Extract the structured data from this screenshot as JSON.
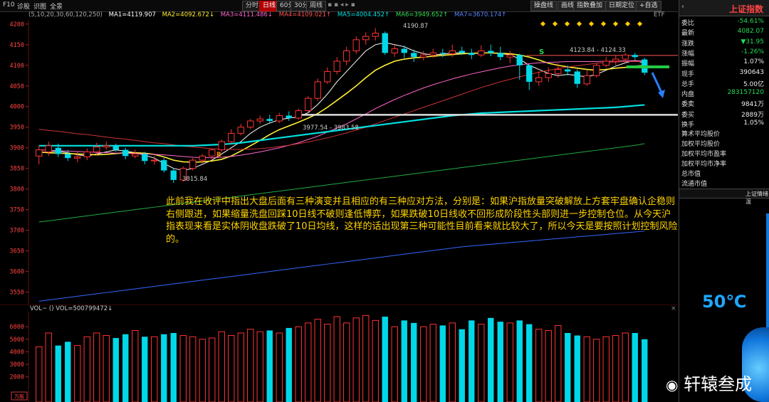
{
  "toolbar": {
    "left_items": [
      "F10",
      "诊股",
      "识图",
      "全景"
    ],
    "periods": [
      "分时",
      "日线",
      "60分",
      "30分",
      "周线"
    ],
    "active_period": "日线",
    "right_buttons": [
      "操盘线",
      "画线",
      "指数叠加",
      "日期定位",
      "+自选"
    ],
    "etf_label": "ETF"
  },
  "ma": {
    "params": "(5,10,20,30,60,120,250)",
    "ma1": "MA1=4119.907",
    "ma2": "MA2=4092.672↓",
    "ma3": "MA3=4111.486↓",
    "ma4": "MA4=4109.021↑",
    "ma5": "MA5=4004.452↑",
    "ma6": "MA6=3949.652↑",
    "ma7": "MA7=3670.174↑"
  },
  "chart_annotations": {
    "high": "4190.87",
    "low": "3815.84",
    "range1": "3977.54 - 3983.58",
    "range2": "4123.84 - 4124.33",
    "b_label": "B",
    "s_label": "S"
  },
  "vol_header": "VOL~  () VOL=500799472↓",
  "vol_unit": "万股",
  "annotation_text": "此前我在收评中指出大盘后面有三种演变并且相应的有三种应对方法，分别是：如果沪指放量突破解放上方套牢盘确认企稳则右侧跟进，如果缩量洗盘回踩10日线不破则逢低博弈，如果跌破10日线收不回形成阶段性头部则进一步控制仓位。从今天沪指表现来看是实体阴收盘跌破了10日均线，这样的话出现第三种可能性目前看来就比较大了，所以今天是要按照计划控制风险的。",
  "side": {
    "title": "上证指数",
    "rows": [
      {
        "k": "委比",
        "v": "-54.61%",
        "c": "green"
      },
      {
        "k": "最新",
        "v": "4082.07",
        "c": "green"
      },
      {
        "k": "涨跌",
        "v": "▼31.95",
        "c": "green"
      },
      {
        "k": "涨幅",
        "v": "-1.26%",
        "c": "green"
      },
      {
        "k": "振幅",
        "v": "1.07%",
        "c": "white"
      },
      {
        "k": "现手",
        "v": "390643",
        "c": "white"
      },
      {
        "k": "总手",
        "v": "5.00亿",
        "c": "white"
      },
      {
        "k": "内盘",
        "v": "283157120",
        "c": "green"
      },
      {
        "k": "委卖",
        "v": "9841万",
        "c": "white"
      },
      {
        "k": "委买",
        "v": "2889万",
        "c": "white"
      },
      {
        "k": "换手",
        "v": "1.05%",
        "c": "white"
      }
    ],
    "links": [
      "算术平均股价",
      "加权平均股价",
      "加权平均市盈率",
      "加权平均市净率",
      "总市值",
      "流通市值"
    ],
    "panel_title": "上证情绪温",
    "temperature": "50℃"
  },
  "watermark": "轩辕叁成",
  "chart_data": {
    "type": "candlestick",
    "y_ticks": [
      4200,
      4150,
      4100,
      4050,
      4000,
      3950,
      3900,
      3850,
      3800,
      3750,
      3700,
      3650,
      3600,
      3550
    ],
    "ylim": [
      3520,
      4210
    ],
    "vol_ticks": [
      6000,
      5000,
      4000,
      3000,
      2000
    ],
    "vol_ylim": [
      0,
      7200
    ],
    "candles": [
      {
        "o": 3880,
        "c": 3895,
        "h": 3905,
        "l": 3860,
        "v": 4400
      },
      {
        "o": 3890,
        "c": 3905,
        "h": 3915,
        "l": 3880,
        "v": 5500
      },
      {
        "o": 3900,
        "c": 3885,
        "h": 3910,
        "l": 3878,
        "v": 4500
      },
      {
        "o": 3885,
        "c": 3875,
        "h": 3895,
        "l": 3868,
        "v": 4800
      },
      {
        "o": 3875,
        "c": 3878,
        "h": 3890,
        "l": 3865,
        "v": 4500
      },
      {
        "o": 3878,
        "c": 3890,
        "h": 3898,
        "l": 3870,
        "v": 5200
      },
      {
        "o": 3890,
        "c": 3902,
        "h": 3912,
        "l": 3882,
        "v": 5500
      },
      {
        "o": 3902,
        "c": 3905,
        "h": 3915,
        "l": 3895,
        "v": 5300
      },
      {
        "o": 3905,
        "c": 3895,
        "h": 3910,
        "l": 3890,
        "v": 5100
      },
      {
        "o": 3895,
        "c": 3880,
        "h": 3900,
        "l": 3872,
        "v": 5400
      },
      {
        "o": 3880,
        "c": 3885,
        "h": 3895,
        "l": 3875,
        "v": 5700
      },
      {
        "o": 3885,
        "c": 3868,
        "h": 3890,
        "l": 3860,
        "v": 5200
      },
      {
        "o": 3868,
        "c": 3870,
        "h": 3880,
        "l": 3860,
        "v": 5200
      },
      {
        "o": 3870,
        "c": 3845,
        "h": 3875,
        "l": 3840,
        "v": 5400
      },
      {
        "o": 3845,
        "c": 3822,
        "h": 3850,
        "l": 3815,
        "v": 5500
      },
      {
        "o": 3822,
        "c": 3850,
        "h": 3855,
        "l": 3818,
        "v": 5300
      },
      {
        "o": 3850,
        "c": 3870,
        "h": 3875,
        "l": 3845,
        "v": 5200
      },
      {
        "o": 3870,
        "c": 3880,
        "h": 3885,
        "l": 3862,
        "v": 5000
      },
      {
        "o": 3880,
        "c": 3895,
        "h": 3898,
        "l": 3872,
        "v": 5100
      },
      {
        "o": 3895,
        "c": 3915,
        "h": 3920,
        "l": 3890,
        "v": 5600
      },
      {
        "o": 3915,
        "c": 3935,
        "h": 3945,
        "l": 3910,
        "v": 5300
      },
      {
        "o": 3935,
        "c": 3950,
        "h": 3958,
        "l": 3930,
        "v": 5500
      },
      {
        "o": 3950,
        "c": 3965,
        "h": 3970,
        "l": 3945,
        "v": 5800
      },
      {
        "o": 3965,
        "c": 3970,
        "h": 3978,
        "l": 3958,
        "v": 5600
      },
      {
        "o": 3970,
        "c": 3965,
        "h": 3980,
        "l": 3960,
        "v": 5700
      },
      {
        "o": 3965,
        "c": 3978,
        "h": 3985,
        "l": 3960,
        "v": 5500
      },
      {
        "o": 3978,
        "c": 3972,
        "h": 3988,
        "l": 3965,
        "v": 5900
      },
      {
        "o": 3972,
        "c": 3990,
        "h": 3995,
        "l": 3968,
        "v": 6000
      },
      {
        "o": 3990,
        "c": 4020,
        "h": 4025,
        "l": 3985,
        "v": 6300
      },
      {
        "o": 4020,
        "c": 4060,
        "h": 4068,
        "l": 4015,
        "v": 6600
      },
      {
        "o": 4060,
        "c": 4085,
        "h": 4095,
        "l": 4055,
        "v": 6200
      },
      {
        "o": 4085,
        "c": 4110,
        "h": 4120,
        "l": 4078,
        "v": 6800
      },
      {
        "o": 4110,
        "c": 4135,
        "h": 4145,
        "l": 4100,
        "v": 6300
      },
      {
        "o": 4135,
        "c": 4162,
        "h": 4170,
        "l": 4128,
        "v": 6700
      },
      {
        "o": 4162,
        "c": 4170,
        "h": 4180,
        "l": 4150,
        "v": 6900
      },
      {
        "o": 4170,
        "c": 4178,
        "h": 4190,
        "l": 4160,
        "v": 6500
      },
      {
        "o": 4178,
        "c": 4130,
        "h": 4182,
        "l": 4125,
        "v": 6800
      },
      {
        "o": 4130,
        "c": 4140,
        "h": 4150,
        "l": 4120,
        "v": 6000
      },
      {
        "o": 4140,
        "c": 4130,
        "h": 4148,
        "l": 4118,
        "v": 6500
      },
      {
        "o": 4130,
        "c": 4120,
        "h": 4138,
        "l": 4108,
        "v": 6300
      },
      {
        "o": 4120,
        "c": 4125,
        "h": 4135,
        "l": 4112,
        "v": 6000
      },
      {
        "o": 4125,
        "c": 4130,
        "h": 4140,
        "l": 4118,
        "v": 6200
      },
      {
        "o": 4130,
        "c": 4128,
        "h": 4140,
        "l": 4120,
        "v": 6100
      },
      {
        "o": 4128,
        "c": 4135,
        "h": 4150,
        "l": 4120,
        "v": 6300
      },
      {
        "o": 4135,
        "c": 4130,
        "h": 4145,
        "l": 4125,
        "v": 5800
      },
      {
        "o": 4130,
        "c": 4125,
        "h": 4140,
        "l": 4115,
        "v": 6500
      },
      {
        "o": 4125,
        "c": 4135,
        "h": 4148,
        "l": 4120,
        "v": 6200
      },
      {
        "o": 4135,
        "c": 4130,
        "h": 4150,
        "l": 4122,
        "v": 6700
      },
      {
        "o": 4130,
        "c": 4120,
        "h": 4145,
        "l": 4112,
        "v": 6400
      },
      {
        "o": 4120,
        "c": 4125,
        "h": 4135,
        "l": 4105,
        "v": 6300
      },
      {
        "o": 4125,
        "c": 4100,
        "h": 4128,
        "l": 4065,
        "v": 6500
      },
      {
        "o": 4100,
        "c": 4060,
        "h": 4102,
        "l": 4040,
        "v": 6200
      },
      {
        "o": 4060,
        "c": 4070,
        "h": 4085,
        "l": 4050,
        "v": 5800
      },
      {
        "o": 4070,
        "c": 4080,
        "h": 4095,
        "l": 4060,
        "v": 5700
      },
      {
        "o": 4080,
        "c": 4090,
        "h": 4105,
        "l": 4070,
        "v": 6100
      },
      {
        "o": 4090,
        "c": 4085,
        "h": 4100,
        "l": 4075,
        "v": 5500
      },
      {
        "o": 4085,
        "c": 4055,
        "h": 4090,
        "l": 4045,
        "v": 5300
      },
      {
        "o": 4055,
        "c": 4075,
        "h": 4088,
        "l": 4050,
        "v": 5200
      },
      {
        "o": 4075,
        "c": 4100,
        "h": 4105,
        "l": 4070,
        "v": 5000
      },
      {
        "o": 4100,
        "c": 4110,
        "h": 4120,
        "l": 4095,
        "v": 5200
      },
      {
        "o": 4110,
        "c": 4115,
        "h": 4125,
        "l": 4100,
        "v": 5300
      },
      {
        "o": 4115,
        "c": 4125,
        "h": 4130,
        "l": 4110,
        "v": 5500
      },
      {
        "o": 4125,
        "c": 4120,
        "h": 4130,
        "l": 4115,
        "v": 5500
      },
      {
        "o": 4114,
        "c": 4082,
        "h": 4118,
        "l": 4076,
        "v": 5000
      }
    ],
    "ma_lines": [
      {
        "name": "MA5",
        "color": "#ffffff",
        "values": [
          3888,
          3890,
          3892,
          3888,
          3883,
          3880,
          3885,
          3890,
          3895,
          3892,
          3888,
          3882,
          3875,
          3862,
          3850,
          3845,
          3850,
          3860,
          3870,
          3885,
          3900,
          3915,
          3935,
          3950,
          3960,
          3968,
          3972,
          3975,
          3985,
          4005,
          4030,
          4060,
          4085,
          4110,
          4135,
          4150,
          4155,
          4150,
          4145,
          4135,
          4128,
          4125,
          4127,
          4130,
          4130,
          4128,
          4130,
          4130,
          4128,
          4126,
          4115,
          4100,
          4090,
          4080,
          4075,
          4078,
          4075,
          4072,
          4078,
          4088,
          4098,
          4106,
          4112,
          4105
        ]
      },
      {
        "name": "MA10",
        "color": "#ffee33",
        "values": [
          3890,
          3888,
          3887,
          3886,
          3885,
          3884,
          3883,
          3884,
          3886,
          3888,
          3888,
          3887,
          3884,
          3878,
          3870,
          3866,
          3865,
          3866,
          3868,
          3872,
          3880,
          3892,
          3905,
          3918,
          3932,
          3944,
          3953,
          3962,
          3972,
          3983,
          3998,
          4015,
          4032,
          4050,
          4070,
          4088,
          4100,
          4110,
          4115,
          4118,
          4120,
          4122,
          4124,
          4126,
          4128,
          4129,
          4130,
          4130,
          4129,
          4128,
          4125,
          4120,
          4113,
          4105,
          4100,
          4096,
          4093,
          4090,
          4088,
          4090,
          4093,
          4095,
          4098,
          4100
        ]
      },
      {
        "name": "MA20",
        "color": "#ff66cc",
        "values": [
          3895,
          3894,
          3893,
          3892,
          3891,
          3890,
          3889,
          3888,
          3887,
          3887,
          3886,
          3885,
          3884,
          3883,
          3881,
          3879,
          3877,
          3876,
          3876,
          3877,
          3879,
          3882,
          3886,
          3890,
          3895,
          3900,
          3906,
          3912,
          3920,
          3928,
          3938,
          3948,
          3958,
          3970,
          3982,
          3995,
          4006,
          4017,
          4027,
          4036,
          4045,
          4053,
          4060,
          4067,
          4073,
          4079,
          4084,
          4089,
          4094,
          4098,
          4101,
          4104,
          4106,
          4107,
          4108,
          4109,
          4109,
          4109,
          4109,
          4110,
          4110,
          4111,
          4111,
          4111
        ]
      },
      {
        "name": "MA30",
        "color": "#cc3333",
        "values": [
          3945,
          3942,
          3940,
          3937,
          3934,
          3932,
          3929,
          3926,
          3923,
          3921,
          3918,
          3915,
          3912,
          3910,
          3907,
          3904,
          3902,
          3900,
          3898,
          3897,
          3896,
          3896,
          3897,
          3898,
          3900,
          3903,
          3906,
          3910,
          3914,
          3919,
          3924,
          3930,
          3936,
          3943,
          3950,
          3958,
          3966,
          3974,
          3982,
          3990,
          3998,
          4006,
          4014,
          4022,
          4030,
          4038,
          4046,
          4053,
          4060,
          4066,
          4072,
          4078,
          4083,
          4088,
          4092,
          4096,
          4099,
          4102,
          4105,
          4107,
          4108,
          4109,
          4109,
          4109
        ]
      },
      {
        "name": "MA60",
        "color": "#00e0e0",
        "values": [
          3905,
          3905,
          3905,
          3905,
          3905,
          3905,
          3905,
          3905,
          3905,
          3905,
          3905,
          3905,
          3905,
          3905,
          3905,
          3905,
          3905,
          3906,
          3907,
          3908,
          3910,
          3912,
          3915,
          3918,
          3921,
          3924,
          3927,
          3930,
          3933,
          3936,
          3939,
          3942,
          3945,
          3948,
          3951,
          3954,
          3957,
          3960,
          3963,
          3966,
          3969,
          3972,
          3975,
          3978,
          3980,
          3982,
          3984,
          3985,
          3986,
          3987,
          3988,
          3989,
          3990,
          3991,
          3992,
          3993,
          3994,
          3995,
          3996,
          3997,
          3998,
          4000,
          4002,
          4004
        ]
      },
      {
        "name": "MA120",
        "color": "#22aa44",
        "values": [
          3720,
          3723,
          3726,
          3729,
          3732,
          3735,
          3738,
          3741,
          3744,
          3747,
          3750,
          3753,
          3756,
          3759,
          3762,
          3765,
          3768,
          3771,
          3774,
          3777,
          3780,
          3783,
          3786,
          3789,
          3792,
          3795,
          3798,
          3801,
          3804,
          3807,
          3810,
          3813,
          3816,
          3819,
          3822,
          3825,
          3828,
          3831,
          3834,
          3837,
          3840,
          3843,
          3846,
          3849,
          3852,
          3855,
          3858,
          3861,
          3864,
          3867,
          3870,
          3873,
          3876,
          3879,
          3882,
          3885,
          3888,
          3891,
          3894,
          3897,
          3900,
          3903,
          3906,
          3910
        ]
      },
      {
        "name": "MA250",
        "color": "#3366ff",
        "values": [
          3528,
          3531,
          3534,
          3537,
          3540,
          3543,
          3546,
          3549,
          3552,
          3555,
          3558,
          3561,
          3564,
          3567,
          3570,
          3573,
          3576,
          3579,
          3582,
          3585,
          3588,
          3591,
          3594,
          3597,
          3600,
          3603,
          3606,
          3609,
          3612,
          3615,
          3618,
          3621,
          3624,
          3627,
          3630,
          3633,
          3636,
          3639,
          3642,
          3645,
          3648,
          3651,
          3654,
          3657,
          3660,
          3662,
          3664,
          3666,
          3668,
          3670,
          3672,
          3674,
          3676,
          3678,
          3680,
          3682,
          3684,
          3686,
          3688,
          3690,
          3692,
          3694,
          3696,
          3698
        ]
      }
    ],
    "hlines": [
      {
        "y": 3980,
        "color": "#dddddd"
      },
      {
        "y": 4124,
        "color": "#ff5555"
      }
    ]
  }
}
